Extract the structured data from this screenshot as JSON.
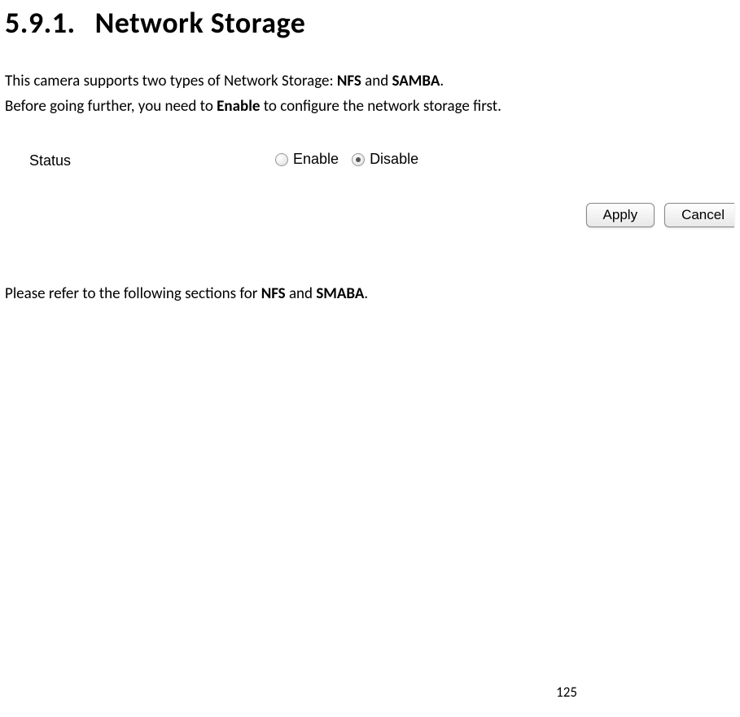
{
  "heading": {
    "number": "5.9.1.",
    "title": "Network Storage"
  },
  "intro": {
    "line1_pre": "This camera supports two types of Network Storage: ",
    "line1_bold1": "NFS",
    "line1_mid": " and ",
    "line1_bold2": "SAMBA",
    "line1_post": ".",
    "line2_pre": "Before going further, you need to ",
    "line2_bold": "Enable",
    "line2_post": " to configure the network storage first."
  },
  "screenshot": {
    "status_label": "Status",
    "radio_enable": "Enable",
    "radio_disable": "Disable",
    "selected": "disable",
    "apply_button": "Apply",
    "cancel_button": "Cancel"
  },
  "refer": {
    "pre": "Please refer to the following sections for ",
    "bold1": "NFS",
    "mid": " and ",
    "bold2": "SMABA",
    "post": "."
  },
  "page_number": "125"
}
